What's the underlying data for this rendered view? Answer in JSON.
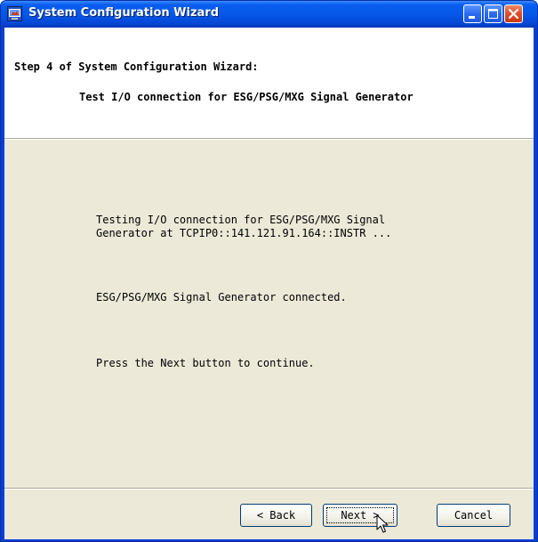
{
  "window": {
    "title": "System Configuration Wizard"
  },
  "header": {
    "step_title": "Step 4 of System Configuration Wizard:",
    "step_subtitle": "Test I/O connection for ESG/PSG/MXG Signal Generator"
  },
  "messages": {
    "testing": "Testing I/O connection for ESG/PSG/MXG Signal\nGenerator at TCPIP0::141.121.91.164::INSTR ...",
    "connected": "ESG/PSG/MXG Signal Generator connected.",
    "instruction": "Press the Next button to continue."
  },
  "buttons": {
    "back": "< Back",
    "next": "Next >",
    "cancel": "Cancel"
  },
  "colors": {
    "titlebar": "#0a5ef0",
    "dialog_face": "#ece9d8",
    "header_bg": "#ffffff",
    "button_border": "#003c74"
  },
  "icons": {
    "app": "wizard-app-icon",
    "minimize": "minimize-icon",
    "maximize": "maximize-icon",
    "close": "close-icon",
    "pointer": "mouse-pointer-icon"
  }
}
